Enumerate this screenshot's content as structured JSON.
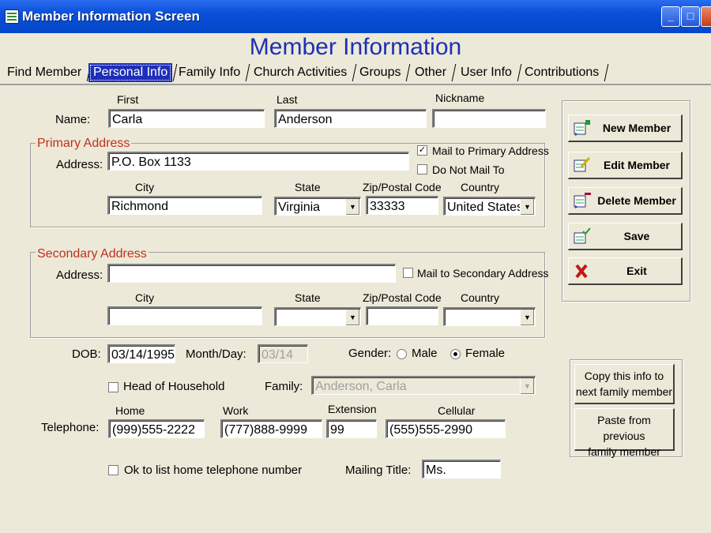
{
  "window": {
    "title": "Member Information Screen"
  },
  "heading": "Member Information",
  "tabs": [
    "Find Member",
    "Personal Info",
    "Family Info",
    "Church Activities",
    "Groups",
    "Other",
    "User Info",
    "Contributions"
  ],
  "name": {
    "label": "Name:",
    "first_label": "First",
    "first": "Carla",
    "last_label": "Last",
    "last": "Anderson",
    "nickname_label": "Nickname",
    "nickname": ""
  },
  "primary": {
    "title": "Primary Address",
    "address_label": "Address:",
    "address": "P.O. Box 1133",
    "mail_to_label": "Mail to Primary Address",
    "mail_to_checked": "✓",
    "do_not_mail_label": "Do Not Mail To",
    "city_label": "City",
    "city": "Richmond",
    "state_label": "State",
    "state": "Virginia",
    "zip_label": "Zip/Postal Code",
    "zip": "33333",
    "country_label": "Country",
    "country": "United States"
  },
  "secondary": {
    "title": "Secondary Address",
    "address_label": "Address:",
    "address": "",
    "mail_to_label": "Mail to Secondary Address",
    "city_label": "City",
    "city": "",
    "state_label": "State",
    "state": "",
    "zip_label": "Zip/Postal Code",
    "zip": "",
    "country_label": "Country",
    "country": ""
  },
  "dob": {
    "label": "DOB:",
    "value": "03/14/1995",
    "monthday_label": "Month/Day:",
    "monthday": "03/14"
  },
  "gender": {
    "label": "Gender:",
    "male": "Male",
    "female": "Female",
    "selected": "Female"
  },
  "household": {
    "head_label": "Head of Household",
    "family_label": "Family:",
    "family": "Anderson, Carla"
  },
  "telephone": {
    "label": "Telephone:",
    "home_label": "Home",
    "home": "(999)555-2222",
    "work_label": "Work",
    "work": "(777)888-9999",
    "ext_label": "Extension",
    "ext": "99",
    "cell_label": "Cellular",
    "cell": "(555)555-2990"
  },
  "ok_list_label": "Ok to list home telephone number",
  "mailing": {
    "label": "Mailing Title:",
    "value": "Ms."
  },
  "actions": {
    "new": "New Member",
    "edit": "Edit Member",
    "delete": "Delete Member",
    "save": "Save",
    "exit": "Exit"
  },
  "copy": {
    "copy_line1": "Copy this info to",
    "copy_line2": "next family member",
    "paste_line1": "Paste from previous",
    "paste_line2": "family member"
  },
  "colors": {
    "title_bar": "#0a4fd9",
    "heading": "#1e2fb4",
    "group_title": "#c03020",
    "active_tab": "#1d2fb8",
    "background": "#ece9d8"
  }
}
